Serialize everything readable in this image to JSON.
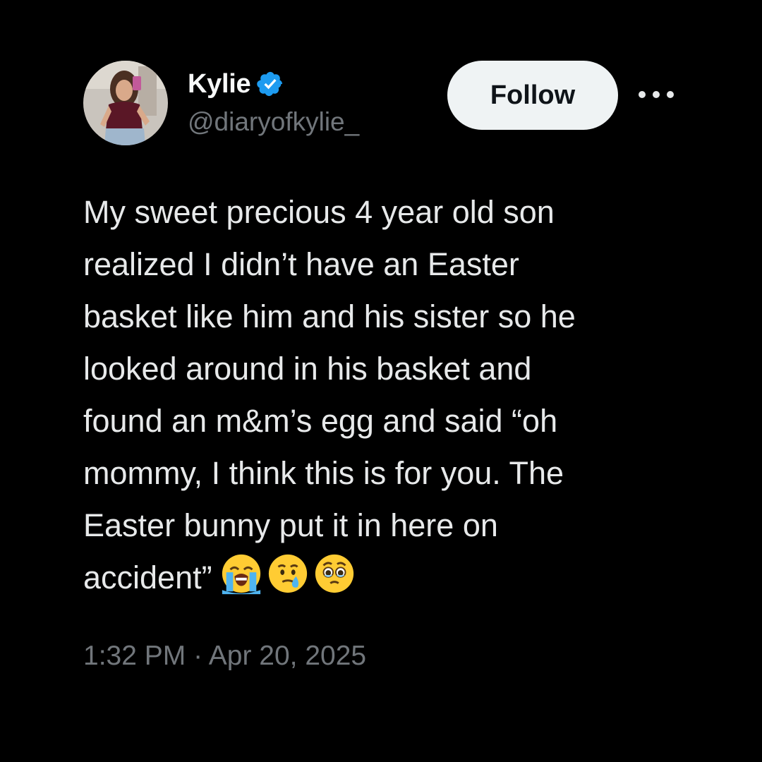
{
  "author": {
    "display_name": "Kylie",
    "handle": "@diaryofkylie_",
    "verified": true,
    "verified_color": "#1d9bf0",
    "avatar": "profile-photo"
  },
  "actions": {
    "follow_label": "Follow",
    "more_icon": "more-horizontal-icon"
  },
  "tweet": {
    "text": "My sweet precious 4 year old son\nrealized I didn’t have an Easter\nbasket like him and his sister so he\nlooked around in his basket and\nfound an m&m’s egg and said “oh\nmommy, I think this is for you. The\nEaster bunny put it in here on\naccident”",
    "emojis": [
      "loudly-crying-face",
      "face-holding-back-tears-tear",
      "face-holding-back-tears"
    ]
  },
  "meta": {
    "timestamp": "1:32 PM · Apr 20, 2025"
  },
  "colors": {
    "background": "#000000",
    "primary_text": "#e7e9ea",
    "secondary_text": "#71767b",
    "follow_bg": "#eff3f4"
  }
}
